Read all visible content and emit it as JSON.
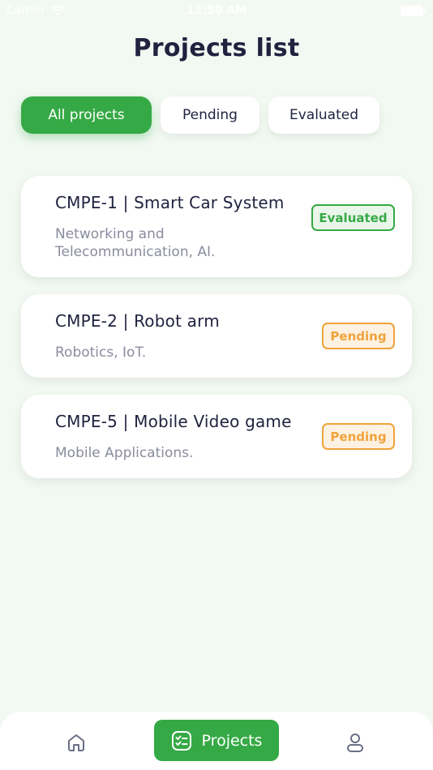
{
  "status_bar": {
    "carrier": "Carrier",
    "time": "12:59 AM"
  },
  "header": {
    "title": "Projects list"
  },
  "filters": {
    "all": "All projects",
    "pending": "Pending",
    "evaluated": "Evaluated",
    "active": "all"
  },
  "projects": [
    {
      "title": "CMPE-1 | Smart Car System",
      "subtitle": "Networking and Telecommunication, AI.",
      "status": "Evaluated"
    },
    {
      "title": "CMPE-2 | Robot arm",
      "subtitle": "Robotics, IoT.",
      "status": "Pending"
    },
    {
      "title": "CMPE-5 | Mobile Video game",
      "subtitle": "Mobile Applications.",
      "status": "Pending"
    }
  ],
  "bottom_nav": {
    "home_icon": "home-icon",
    "projects_label": "Projects",
    "projects_icon": "checklist-icon",
    "profile_icon": "user-icon",
    "active": "projects"
  },
  "colors": {
    "background": "#f2f9f2",
    "primary_green": "#35a945",
    "pending_orange": "#f0a33a",
    "title_text": "#20233f",
    "subtitle_text": "#8a8c9e"
  }
}
